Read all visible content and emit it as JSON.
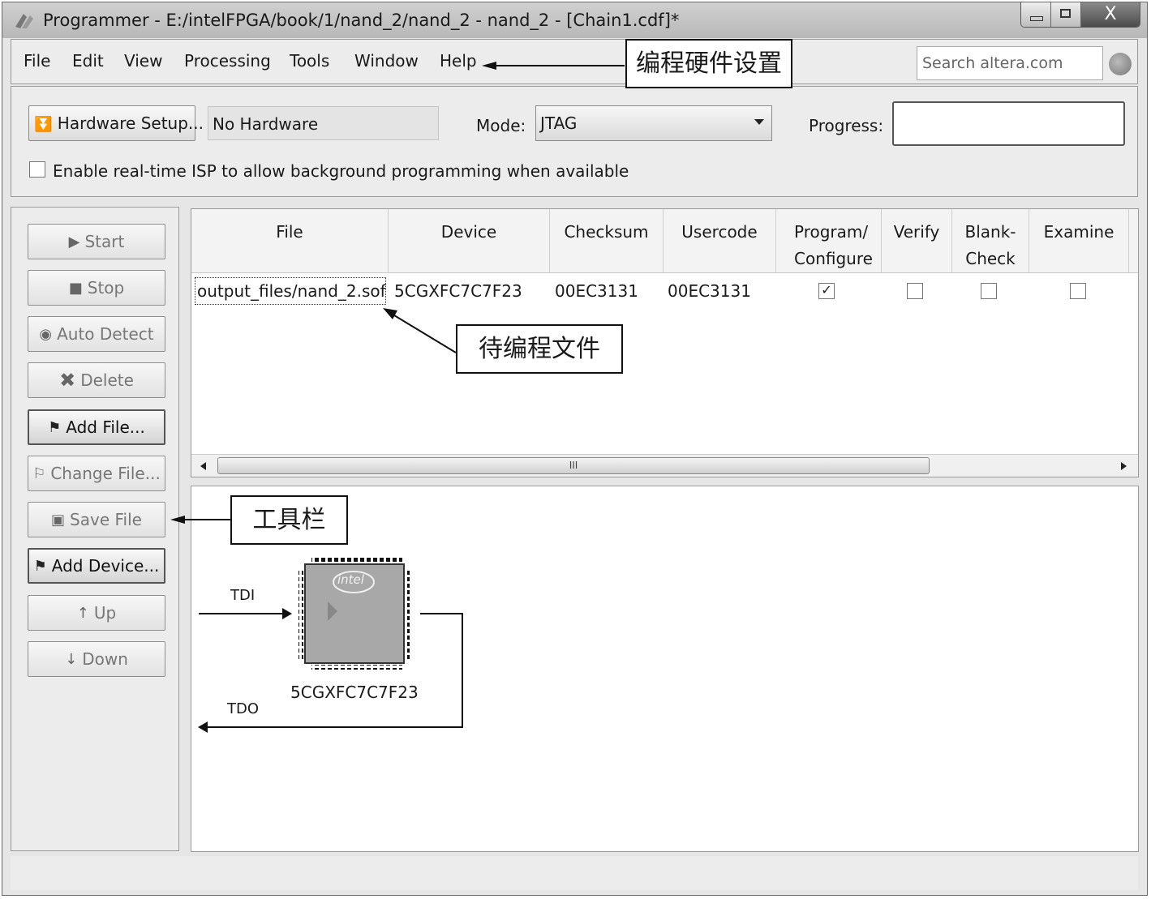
{
  "window": {
    "title": "Programmer - E:/intelFPGA/book/1/nand_2/nand_2 - nand_2 - [Chain1.cdf]*",
    "close_glyph": "X"
  },
  "menu": {
    "items": [
      "File",
      "Edit",
      "View",
      "Processing",
      "Tools",
      "Window",
      "Help"
    ],
    "search_placeholder": "Search altera.com"
  },
  "hardware": {
    "setup_button": "Hardware Setup...",
    "hardware_value": "No Hardware",
    "mode_label": "Mode:",
    "mode_value": "JTAG",
    "progress_label": "Progress:",
    "progress": 0,
    "isp_label": "Enable real-time ISP to allow background programming when available",
    "isp_checked": false
  },
  "toolbar": {
    "buttons": [
      {
        "label": "Start",
        "icon": "start-icon",
        "enabled": false
      },
      {
        "label": "Stop",
        "icon": "stop-icon",
        "enabled": false
      },
      {
        "label": "Auto Detect",
        "icon": "auto-detect-icon",
        "enabled": false
      },
      {
        "label": "Delete",
        "icon": "delete-icon",
        "enabled": false
      },
      {
        "label": "Add File...",
        "icon": "add-file-icon",
        "enabled": true
      },
      {
        "label": "Change File...",
        "icon": "change-file-icon",
        "enabled": false
      },
      {
        "label": "Save File",
        "icon": "save-icon",
        "enabled": false
      },
      {
        "label": "Add Device...",
        "icon": "add-device-icon",
        "enabled": true
      },
      {
        "label": "Up",
        "icon": "up-icon",
        "enabled": false
      },
      {
        "label": "Down",
        "icon": "down-icon",
        "enabled": false
      }
    ]
  },
  "table": {
    "headers": [
      "File",
      "Device",
      "Checksum",
      "Usercode",
      "Program/ Configure",
      "Verify",
      "Blank- Check",
      "Examine"
    ],
    "rows": [
      {
        "file": "output_files/nand_2.sof",
        "device": "5CGXFC7C7F23",
        "checksum": "00EC3131",
        "usercode": "00EC3131",
        "program": true,
        "verify": false,
        "blank_check": false,
        "examine": false
      }
    ],
    "scroll_thumb_label": "III"
  },
  "chain": {
    "tdi_label": "TDI",
    "tdo_label": "TDO",
    "device_name": "5CGXFC7C7F23",
    "chip_logo": "intel"
  },
  "annotations": {
    "hardware_setup_note": "编程硬件设置",
    "file_note": "待编程文件",
    "toolbar_note": "工具栏"
  }
}
